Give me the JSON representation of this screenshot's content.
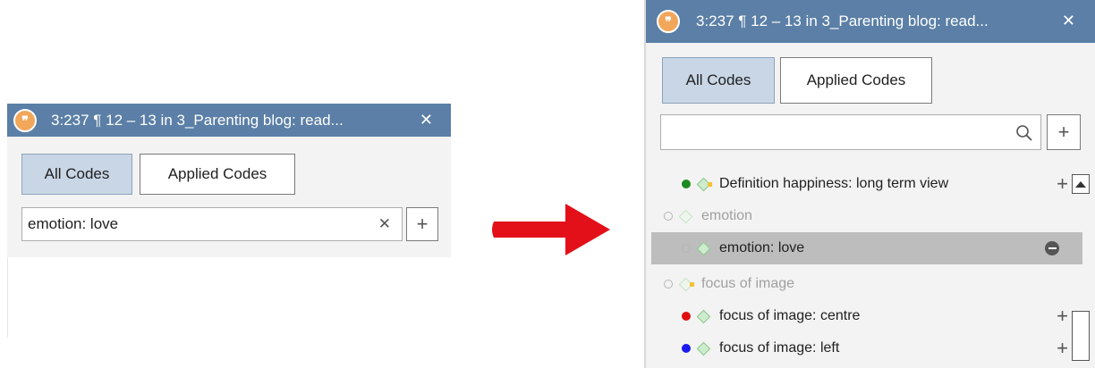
{
  "left_panel": {
    "title": "3:237 ¶ 12 – 13 in 3_Parenting blog: read...",
    "tabs": {
      "all_codes": "All Codes",
      "applied_codes": "Applied Codes"
    },
    "search_value": "emotion: love",
    "clear_glyph": "✕",
    "add_glyph": "+"
  },
  "right_panel": {
    "title": "3:237 ¶ 12 – 13 in 3_Parenting blog: read...",
    "tabs": {
      "all_codes": "All Codes",
      "applied_codes": "Applied Codes"
    },
    "search_value": "",
    "add_glyph": "+",
    "codes": [
      {
        "label": "Definition happiness: long term view",
        "dot_color": "#1f8a1f",
        "state": "normal",
        "action": "+"
      },
      {
        "label": "emotion",
        "dot_color": "",
        "state": "faded",
        "action": ""
      },
      {
        "label": "emotion: love",
        "dot_color": "",
        "state": "selected",
        "action": "remove"
      },
      {
        "label": "focus of image",
        "dot_color": "",
        "state": "faded",
        "action": ""
      },
      {
        "label": "focus of image: centre",
        "dot_color": "#e01010",
        "state": "normal",
        "action": "+"
      },
      {
        "label": "focus of image: left",
        "dot_color": "#1a1aee",
        "state": "normal",
        "action": "+"
      }
    ]
  },
  "icons": {
    "quote": "quote-icon",
    "close": "close-icon",
    "search": "search-icon",
    "add": "plus-icon",
    "arrow": "right-arrow-icon",
    "remove": "remove-icon"
  },
  "colors": {
    "titlebar": "#5b7fa6",
    "active_tab": "#c8d6e6",
    "selected_row": "#bdbdbd",
    "arrow": "#e3101a",
    "quote_icon": "#f2a65a"
  }
}
